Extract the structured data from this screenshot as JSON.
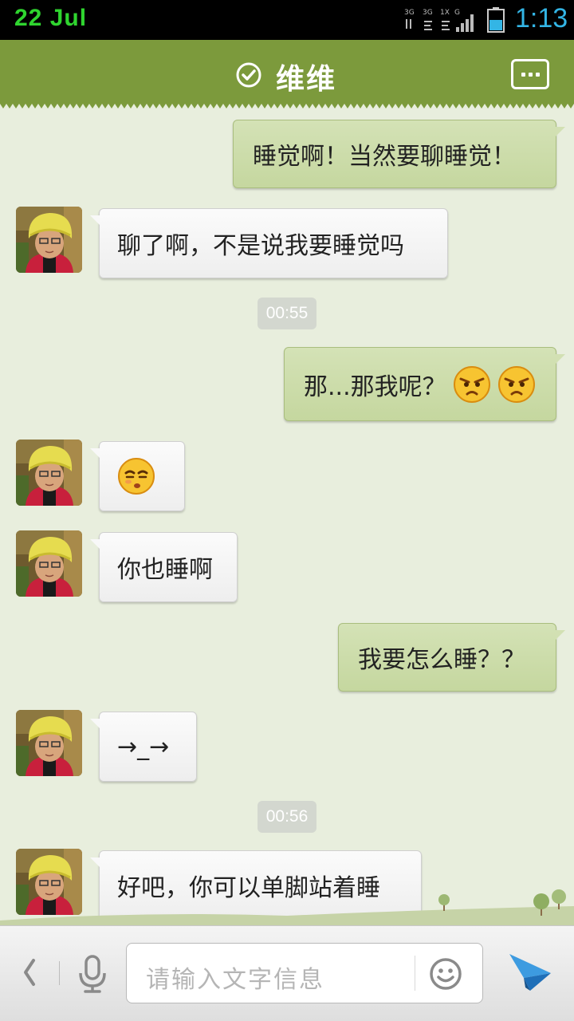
{
  "status_bar": {
    "date": "22 Jul",
    "time": "1:13",
    "network_labels": [
      "3G",
      "3G",
      "1X",
      "G"
    ]
  },
  "header": {
    "contact_name": "维维",
    "verified_icon": "check-circle-icon",
    "more_icon": "more-dots-icon"
  },
  "messages": [
    {
      "side": "out",
      "text": "睡觉啊！当然要聊睡觉！"
    },
    {
      "side": "in",
      "text": "聊了啊，不是说我要睡觉吗"
    },
    {
      "timestamp": "00:55"
    },
    {
      "side": "out",
      "text": "那...那我呢？",
      "emojis": [
        "angry-face-icon",
        "angry-face-icon"
      ]
    },
    {
      "side": "in",
      "emojis": [
        "sleepy-face-icon"
      ]
    },
    {
      "side": "in",
      "text": "你也睡啊"
    },
    {
      "side": "out",
      "text": "我要怎么睡？？"
    },
    {
      "side": "in",
      "text": "→_→"
    },
    {
      "timestamp": "00:56"
    },
    {
      "side": "in",
      "text": "好吧，你可以单脚站着睡"
    }
  ],
  "input_bar": {
    "placeholder": "请输入文字信息",
    "icons": [
      "back-chevron-icon",
      "microphone-icon",
      "smiley-icon",
      "send-plane-icon"
    ]
  },
  "colors": {
    "header_green": "#7c9a3c",
    "out_bubble": "#c9dba5",
    "in_bubble": "#f4f4f4",
    "background": "#e8eedd",
    "send_blue": "#2d8fd8"
  }
}
